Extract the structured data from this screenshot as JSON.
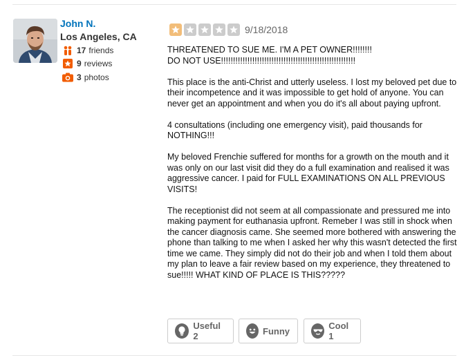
{
  "user": {
    "name": "John N.",
    "location": "Los Angeles, CA",
    "friends_count": "17",
    "friends_label": "friends",
    "reviews_count": "9",
    "reviews_label": "reviews",
    "photos_count": "3",
    "photos_label": "photos"
  },
  "review": {
    "rating": 1,
    "rating_max": 5,
    "date": "9/18/2018",
    "paragraphs": [
      "THREATENED TO SUE ME. I'M A PET OWNER!!!!!!!!\nDO NOT USE!!!!!!!!!!!!!!!!!!!!!!!!!!!!!!!!!!!!!!!!!!!!!!!!!!!!!!!!",
      "This place is the anti-Christ and utterly useless. I lost my beloved pet due to their incompetence and it was impossible to get hold of anyone. You can never get an appointment and when you do it's all about paying upfront.",
      "4 consultations (including one emergency visit), paid thousands for NOTHING!!!",
      "My beloved Frenchie suffered for months for a growth on the mouth and it was only on our last visit did they do a full examination and realised it was aggressive cancer. I paid for FULL EXAMINATIONS ON ALL PREVIOUS VISITS!",
      "The receptionist did not seem at all compassionate and pressured me into making payment for euthanasia upfront. Remeber I was still in shock when the cancer diagnosis came. She seemed more bothered with answering the phone than talking to me when I asked her why this wasn't detected the first time we came. They simply did not do their job and when I told them about my plan to leave a fair review based on my experience, they threatened to sue!!!!! WHAT KIND OF PLACE IS THIS?????"
    ]
  },
  "votes": {
    "useful_label": "Useful 2",
    "funny_label": "Funny",
    "cool_label": "Cool 1"
  },
  "colors": {
    "link": "#0073bb",
    "star_on": "#f2bd79",
    "star_off": "#cccccc",
    "friends_icon": "#f15c00",
    "reviews_icon": "#f15c00",
    "photos_icon": "#f15c00"
  }
}
